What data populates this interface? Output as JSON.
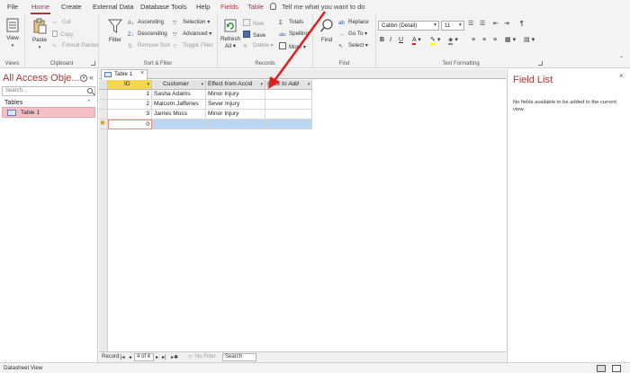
{
  "ribbon_tabs": [
    "File",
    "Home",
    "Create",
    "External Data",
    "Database Tools",
    "Help",
    "Fields",
    "Table"
  ],
  "active_tab": "Home",
  "tell_me": "Tell me what you want to do",
  "groups": {
    "views": {
      "label": "Views",
      "view": "View"
    },
    "clipboard": {
      "label": "Clipboard",
      "paste": "Paste",
      "cut": "Cut",
      "copy": "Copy",
      "format_painter": "Format Painter"
    },
    "sort_filter": {
      "label": "Sort & Filter",
      "filter": "Filter",
      "ascending": "Ascending",
      "descending": "Descending",
      "remove_sort": "Remove Sort",
      "selection": "Selection",
      "advanced": "Advanced",
      "toggle_filter": "Toggle Filter"
    },
    "records": {
      "label": "Records",
      "refresh": "Refresh",
      "refresh_all": "All",
      "new": "New",
      "save": "Save",
      "delete": "Delete",
      "totals": "Totals",
      "spelling": "Spelling",
      "more": "More"
    },
    "find": {
      "label": "Find",
      "find": "Find",
      "replace": "Replace",
      "goto": "Go To",
      "select": "Select"
    },
    "text_formatting": {
      "label": "Text Formatting",
      "font": "Calibri (Detail)",
      "size": "11"
    }
  },
  "nav": {
    "title": "All Access Obje...",
    "search_placeholder": "Search...",
    "section": "Tables",
    "items": [
      {
        "label": "Table 1"
      }
    ]
  },
  "document_tab": "Table 1",
  "table": {
    "columns": [
      "ID",
      "Customer",
      "Effect from Accid",
      "Click to Add"
    ],
    "rows": [
      {
        "id": "1",
        "customer": "Sasha Adams",
        "effect": "Minor Injury"
      },
      {
        "id": "2",
        "customer": "Malcom Jafferies",
        "effect": "Sever Injury"
      },
      {
        "id": "3",
        "customer": "James Moss",
        "effect": "Minor Injury"
      }
    ],
    "new_row_id": "0"
  },
  "record_nav": {
    "label": "Record:",
    "position": "4 of 4",
    "filter": "No Filter",
    "search": "Search"
  },
  "field_list": {
    "title": "Field List",
    "message": "No fields available to be added to the current view."
  },
  "status_bar": {
    "text": "Datasheet View"
  },
  "colors": {
    "accent": "#a4373a",
    "selected_header": "#f8d74c",
    "new_row": "#b9d7f3",
    "nav_item": "#f4c0c5",
    "arrow": "#e02020"
  }
}
